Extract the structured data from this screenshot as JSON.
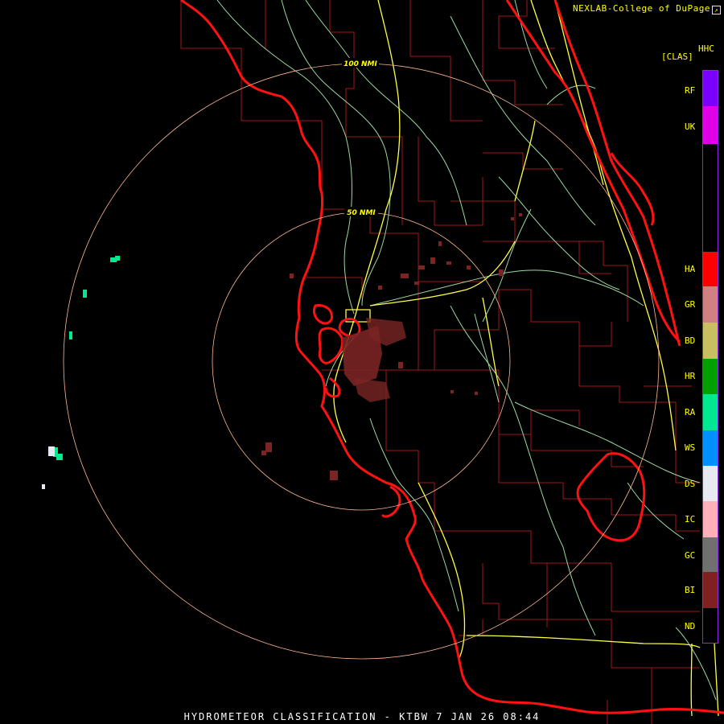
{
  "credit": "NEXLAB-College of DuPage",
  "legend": {
    "product": "HHC",
    "unit": "[CLAS]",
    "classes": [
      {
        "code": "RF",
        "color": "#7a00ff"
      },
      {
        "code": "UK",
        "color": "#e000e8"
      },
      {
        "code": "HA",
        "color": "#ff0000"
      },
      {
        "code": "GR",
        "color": "#d08080"
      },
      {
        "code": "BD",
        "color": "#c8c060"
      },
      {
        "code": "HR",
        "color": "#00a000"
      },
      {
        "code": "RA",
        "color": "#00e890"
      },
      {
        "code": "WS",
        "color": "#0090ff"
      },
      {
        "code": "DS",
        "color": "#e8e8f0"
      },
      {
        "code": "IC",
        "color": "#ffb0b8"
      },
      {
        "code": "GC",
        "color": "#707070"
      },
      {
        "code": "BI",
        "color": "#802020"
      },
      {
        "code": "ND",
        "color": "#000000"
      }
    ]
  },
  "range_rings": {
    "inner": "50 NMI",
    "outer": "100 NMI"
  },
  "footer": "HYDROMETEOR CLASSIFICATION - KTBW 7 JAN 26 08:44"
}
